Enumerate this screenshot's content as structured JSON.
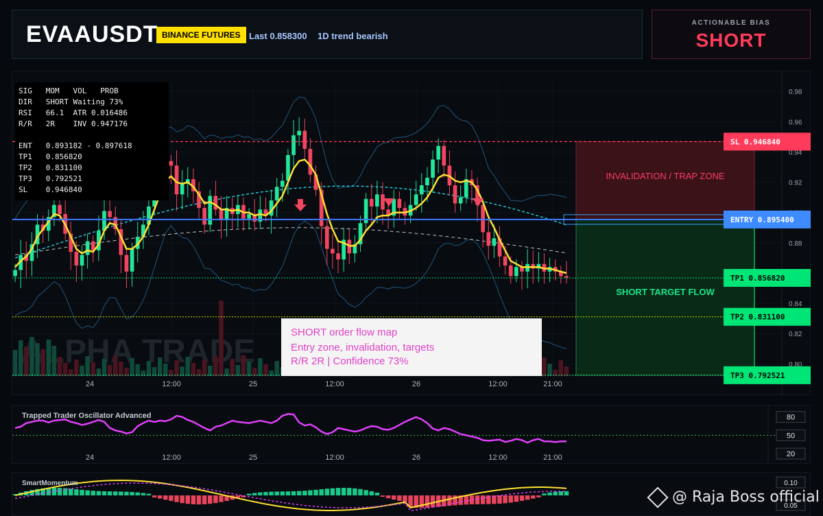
{
  "header": {
    "symbol": "EVAAUSDT",
    "exchange": "BINANCE FUTURES",
    "last": "Last 0.858300",
    "trend": "1D trend bearish"
  },
  "bias": {
    "label": "ACTIONABLE BIAS",
    "value": "SHORT"
  },
  "info_table": {
    "rows": [
      "SIG   MOM   VOL   PROB",
      "DIR   SHORT Waiting 73%",
      "RSI   66.1  ATR 0.016486",
      "R/R   2R    INV 0.947176",
      "ENT   0.893182 - 0.897618",
      "TP1   0.856820",
      "TP2   0.831100",
      "TP3   0.792521",
      "SL    0.946840"
    ]
  },
  "zones": {
    "invalidation_label": "INVALIDATION / TRAP ZONE",
    "target_label": "SHORT TARGET FLOW"
  },
  "levels": {
    "sl": "SL 0.946840",
    "entry": "ENTRY 0.895400",
    "tp1": "TP1 0.856820",
    "tp2": "TP2 0.831100",
    "tp3": "TP3 0.792521"
  },
  "flow_box": {
    "line1": "SHORT order flow map",
    "line2": "Entry zone, invalidation, targets",
    "line3": "R/R 2R | Confidence 73%"
  },
  "colors": {
    "up": "#22e69a",
    "down": "#f0465f",
    "ema": "#ffe033",
    "band": "#26c6da",
    "entry": "#3d7bff",
    "sl": "#ff3b5c",
    "tp": "#00e676",
    "osc": "#e040fb"
  },
  "watermark": "@ Raja Boss official",
  "chart_data": [
    {
      "type": "candlestick",
      "symbol": "EVAAUSDT",
      "yticks": [
        0.8,
        0.82,
        0.84,
        0.86,
        0.88,
        0.9,
        0.92,
        0.94,
        0.96,
        0.98
      ],
      "ytick_labels": [
        "0.80",
        "0.82",
        "0.84",
        "",
        "0.88",
        "0.90",
        "0.92",
        "0.94",
        "0.96",
        "0.98"
      ],
      "ylim": [
        0.792,
        0.986
      ],
      "xtick_labels": [
        "24",
        "12:00",
        "25",
        "12:00",
        "26",
        "12:00",
        "21:00"
      ],
      "levels": {
        "sl": 0.94684,
        "entry": 0.8954,
        "tp1": 0.85682,
        "tp2": 0.8311,
        "tp3": 0.792521
      },
      "close": [
        0.862,
        0.872,
        0.868,
        0.879,
        0.892,
        0.888,
        0.897,
        0.905,
        0.899,
        0.886,
        0.874,
        0.865,
        0.872,
        0.881,
        0.875,
        0.888,
        0.901,
        0.897,
        0.889,
        0.872,
        0.861,
        0.876,
        0.884,
        0.892,
        0.904,
        0.918,
        0.928,
        0.934,
        0.931,
        0.912,
        0.919,
        0.922,
        0.914,
        0.903,
        0.892,
        0.911,
        0.902,
        0.895,
        0.903,
        0.899,
        0.905,
        0.896,
        0.899,
        0.894,
        0.902,
        0.898,
        0.908,
        0.917,
        0.921,
        0.938,
        0.951,
        0.954,
        0.942,
        0.925,
        0.915,
        0.891,
        0.876,
        0.873,
        0.869,
        0.882,
        0.873,
        0.879,
        0.893,
        0.909,
        0.904,
        0.912,
        0.902,
        0.898,
        0.909,
        0.903,
        0.898,
        0.905,
        0.912,
        0.918,
        0.923,
        0.935,
        0.944,
        0.931,
        0.918,
        0.906,
        0.91,
        0.922,
        0.918,
        0.905,
        0.887,
        0.878,
        0.883,
        0.871,
        0.865,
        0.858,
        0.864,
        0.861,
        0.866,
        0.863,
        0.866,
        0.861,
        0.864,
        0.861,
        0.858,
        0.857
      ],
      "ema": [
        0.864,
        0.868,
        0.871,
        0.876,
        0.884,
        0.889,
        0.894,
        0.899,
        0.898,
        0.892,
        0.884,
        0.876,
        0.873,
        0.875,
        0.874,
        0.879,
        0.888,
        0.893,
        0.892,
        0.884,
        0.876,
        0.876,
        0.879,
        0.884,
        0.892,
        0.902,
        0.912,
        0.921,
        0.924,
        0.92,
        0.919,
        0.92,
        0.917,
        0.912,
        0.906,
        0.907,
        0.905,
        0.902,
        0.902,
        0.901,
        0.902,
        0.9,
        0.9,
        0.898,
        0.899,
        0.898,
        0.901,
        0.906,
        0.911,
        0.92,
        0.929,
        0.934,
        0.935,
        0.931,
        0.925,
        0.912,
        0.899,
        0.889,
        0.881,
        0.88,
        0.878,
        0.878,
        0.882,
        0.888,
        0.892,
        0.897,
        0.898,
        0.898,
        0.9,
        0.9,
        0.9,
        0.901,
        0.903,
        0.906,
        0.91,
        0.916,
        0.923,
        0.925,
        0.924,
        0.921,
        0.92,
        0.921,
        0.92,
        0.915,
        0.907,
        0.897,
        0.89,
        0.882,
        0.875,
        0.868,
        0.866,
        0.864,
        0.864,
        0.864,
        0.864,
        0.863,
        0.863,
        0.862,
        0.861,
        0.86
      ]
    },
    {
      "type": "line",
      "title": "Trapped Trader Oscillator Advanced",
      "yticks": [
        20,
        50,
        80
      ],
      "ylim": [
        10,
        92
      ],
      "values": [
        62,
        64,
        70,
        72,
        74,
        74,
        71,
        74,
        75,
        76,
        72,
        70,
        67,
        69,
        72,
        75,
        72,
        62,
        58,
        56,
        53,
        55,
        65,
        70,
        74,
        72,
        74,
        73,
        76,
        82,
        80,
        75,
        72,
        67,
        62,
        58,
        64,
        66,
        70,
        74,
        72,
        71,
        70,
        72,
        74,
        72,
        70,
        74,
        82,
        85,
        84,
        71,
        66,
        68,
        63,
        56,
        52,
        55,
        62,
        60,
        58,
        56,
        58,
        62,
        65,
        64,
        60,
        59,
        62,
        67,
        72,
        76,
        80,
        76,
        70,
        61,
        58,
        62,
        60,
        56,
        52,
        50,
        48,
        46,
        42,
        41,
        42,
        43,
        39,
        41,
        44,
        42,
        38,
        42,
        44,
        40,
        40,
        39,
        40,
        40
      ],
      "xtick_labels": [
        "24",
        "12:00",
        "25",
        "12:00",
        "26",
        "12:00",
        "21:00"
      ]
    },
    {
      "type": "bar",
      "title": "SmartMomentum",
      "yticks": [
        0.1,
        -0.05
      ],
      "ytick_labels": [
        "0.10",
        "0.05"
      ],
      "ylim": [
        -0.11,
        0.12
      ]
    }
  ]
}
